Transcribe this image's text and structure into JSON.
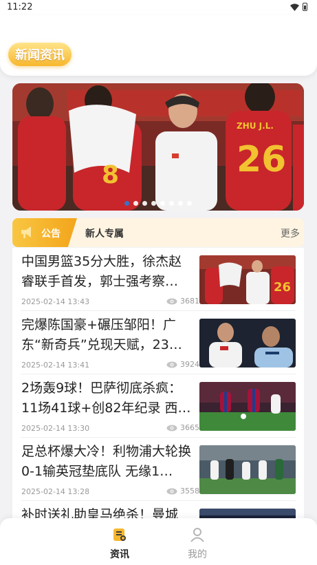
{
  "status_bar": {
    "time": "11:22"
  },
  "header": {
    "title": "新闻资讯"
  },
  "banner": {
    "slide_count": 8,
    "active_index": 0,
    "jersey_number": "26",
    "jersey_name": "ZHU J.L."
  },
  "notice": {
    "tag": "公告",
    "text": "新人专属",
    "more": "更多"
  },
  "news": [
    {
      "title": "中国男篮35分大胜，徐杰赵睿联手首发，郭士强考察…",
      "date": "2025-02-14 13:43",
      "views": "3681"
    },
    {
      "title": "完爆陈国豪+碾压邹阳！广东“新奇兵”兑现天赋，23…",
      "date": "2025-02-14 13:41",
      "views": "3924"
    },
    {
      "title": "2场轰9球！巴萨彻底杀疯：11场41球+创82年纪录 西…",
      "date": "2025-02-14 13:30",
      "views": "3665"
    },
    {
      "title": "足总杯爆大冷！利物浦大轮换0-1输英冠垫底队 无缘1…",
      "date": "2025-02-14 13:28",
      "views": "3558"
    },
    {
      "title": "补时送礼助皇马绝杀！曼城",
      "date": "",
      "views": ""
    }
  ],
  "tabbar": {
    "news_label": "资讯",
    "mine_label": "我的"
  },
  "colors": {
    "accent_gold": "#f3a51b",
    "active_dot": "#2a7ad9",
    "jersey_red": "#c8262b"
  }
}
